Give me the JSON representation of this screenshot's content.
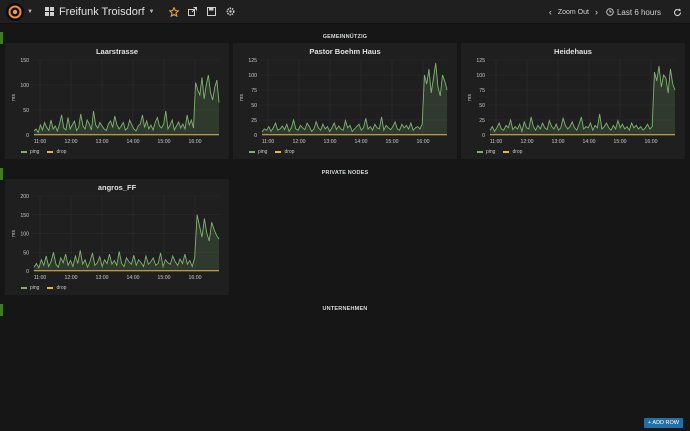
{
  "navbar": {
    "dashboard_title": "Freifunk Troisdorf",
    "zoom_out": "Zoom Out",
    "time_range": "Last 6 hours"
  },
  "rows": [
    {
      "title": "GEMEINNÜTZIG"
    },
    {
      "title": "PRIVATE NODES"
    },
    {
      "title": "UNTERNEHMEN"
    }
  ],
  "add_row_label": "+ ADD ROW",
  "colors": {
    "ping": "#7eb26d",
    "drop": "#eab839",
    "accent": "#3e7c1f"
  },
  "chart_data": [
    {
      "type": "line",
      "title": "Laarstrasse",
      "ylabel": "ms",
      "ylim": [
        0,
        150
      ],
      "yticks": [
        0,
        50,
        100,
        150
      ],
      "xticks": [
        "11:00",
        "12:00",
        "13:00",
        "14:00",
        "15:00",
        "16:00"
      ],
      "series": [
        {
          "name": "ping",
          "values": [
            8,
            12,
            5,
            20,
            10,
            25,
            15,
            9,
            30,
            12,
            18,
            8,
            22,
            40,
            14,
            10,
            35,
            12,
            20,
            28,
            9,
            15,
            42,
            18,
            12,
            30,
            22,
            10,
            48,
            20,
            14,
            25,
            18,
            12,
            9,
            22,
            28,
            15,
            38,
            20,
            12,
            18,
            25,
            10,
            14,
            30,
            20,
            12,
            8,
            18,
            22,
            40,
            15,
            28,
            12,
            20,
            10,
            25,
            35,
            18,
            14,
            22,
            48,
            12,
            20,
            30,
            10,
            18,
            26,
            14,
            22,
            12,
            40,
            20,
            30,
            14,
            105,
            90,
            80,
            115,
            72,
            100,
            120,
            85,
            70,
            95,
            110,
            65
          ]
        },
        {
          "name": "drop",
          "values": [
            0,
            0,
            0,
            0,
            0,
            0,
            0,
            0,
            0,
            0
          ]
        }
      ]
    },
    {
      "type": "line",
      "title": "Pastor Boehm Haus",
      "ylabel": "ms",
      "ylim": [
        0,
        125
      ],
      "yticks": [
        0,
        25,
        50,
        75,
        100,
        125
      ],
      "xticks": [
        "11:00",
        "12:00",
        "13:00",
        "14:00",
        "15:00",
        "16:00"
      ],
      "series": [
        {
          "name": "ping",
          "values": [
            5,
            10,
            8,
            14,
            6,
            12,
            20,
            8,
            10,
            15,
            9,
            18,
            6,
            12,
            25,
            10,
            8,
            16,
            12,
            9,
            20,
            14,
            6,
            10,
            22,
            12,
            8,
            18,
            10,
            14,
            6,
            12,
            20,
            9,
            15,
            10,
            8,
            24,
            12,
            16,
            6,
            10,
            14,
            18,
            8,
            12,
            28,
            10,
            14,
            8,
            18,
            12,
            10,
            30,
            8,
            16,
            12,
            9,
            14,
            22,
            10,
            8,
            18,
            12,
            16,
            10,
            20,
            8,
            12,
            14,
            10,
            18,
            100,
            85,
            110,
            70,
            95,
            120,
            80,
            65,
            100,
            90,
            75
          ]
        },
        {
          "name": "drop",
          "values": [
            0,
            0,
            0,
            0,
            0,
            0,
            0,
            0,
            0,
            0
          ]
        }
      ]
    },
    {
      "type": "line",
      "title": "Heidehaus",
      "ylabel": "ms",
      "ylim": [
        0,
        125
      ],
      "yticks": [
        0,
        25,
        50,
        75,
        100,
        125
      ],
      "xticks": [
        "11:00",
        "12:00",
        "13:00",
        "14:00",
        "15:00",
        "16:00"
      ],
      "series": [
        {
          "name": "ping",
          "values": [
            8,
            14,
            6,
            12,
            20,
            10,
            8,
            16,
            12,
            25,
            9,
            14,
            10,
            18,
            6,
            22,
            12,
            10,
            30,
            14,
            8,
            16,
            10,
            20,
            12,
            9,
            24,
            14,
            10,
            18,
            8,
            12,
            28,
            16,
            10,
            14,
            22,
            12,
            8,
            18,
            30,
            10,
            14,
            12,
            20,
            8,
            16,
            12,
            35,
            10,
            14,
            20,
            12,
            8,
            16,
            10,
            24,
            12,
            18,
            10,
            14,
            8,
            20,
            12,
            16,
            10,
            14,
            8,
            12,
            18,
            10,
            14,
            105,
            90,
            115,
            80,
            100,
            95,
            70,
            110,
            85,
            75
          ]
        },
        {
          "name": "drop",
          "values": [
            0,
            0,
            0,
            0,
            0,
            0,
            0,
            0,
            0,
            0
          ]
        }
      ]
    },
    {
      "type": "line",
      "title": "angros_FF",
      "ylabel": "ms",
      "ylim": [
        0,
        200
      ],
      "yticks": [
        0,
        50,
        100,
        150,
        200
      ],
      "xticks": [
        "11:00",
        "12:00",
        "13:00",
        "14:00",
        "15:00",
        "16:00"
      ],
      "series": [
        {
          "name": "ping",
          "values": [
            10,
            20,
            8,
            30,
            15,
            40,
            12,
            25,
            50,
            18,
            10,
            35,
            22,
            45,
            15,
            28,
            12,
            40,
            20,
            55,
            18,
            30,
            10,
            25,
            48,
            15,
            22,
            38,
            12,
            30,
            20,
            45,
            18,
            28,
            15,
            52,
            20,
            12,
            35,
            25,
            18,
            42,
            15,
            30,
            22,
            12,
            40,
            18,
            25,
            35,
            15,
            20,
            48,
            12,
            30,
            22,
            18,
            40,
            25,
            15,
            32,
            20,
            45,
            18,
            28,
            12,
            35,
            150,
            120,
            90,
            140,
            100,
            80,
            130,
            110,
            95,
            85
          ]
        },
        {
          "name": "drop",
          "values": [
            0,
            0,
            0,
            0,
            0,
            0,
            0,
            0,
            0,
            0
          ]
        }
      ]
    }
  ]
}
